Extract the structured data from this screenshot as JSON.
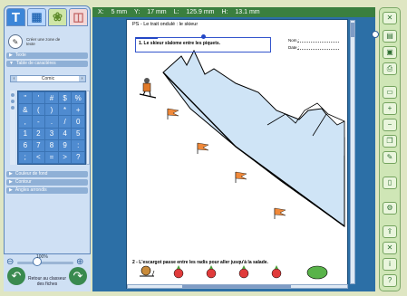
{
  "left_panel": {
    "tabs": [
      {
        "label": "T",
        "icon": "text-icon"
      },
      {
        "label": "",
        "icon": "grid-icon"
      },
      {
        "label": "",
        "icon": "image-icon"
      },
      {
        "label": "",
        "icon": "shapes-icon"
      }
    ],
    "text_box_tool": {
      "label": "Créer une zone de texte"
    },
    "sections": {
      "text": "Texte",
      "char_table": "Table de caractères",
      "bg_color": "Couleur de fond",
      "border": "Contour",
      "rounded_corners": "Angles arrondis"
    },
    "font_select": "Comic",
    "characters": [
      "\"",
      "'",
      "#",
      "$",
      "%",
      "&",
      "(",
      ")",
      "*",
      "+",
      ",",
      "-",
      ".",
      "/",
      "0",
      "1",
      "2",
      "3",
      "4",
      "5",
      "6",
      "7",
      "8",
      "9",
      ":",
      ";",
      "<",
      "=",
      ">",
      "?"
    ],
    "zoom": {
      "value": "100%"
    },
    "back_button": "Retour au classeur des fiches"
  },
  "coords": {
    "x_label": "X:",
    "x_value": "5 mm",
    "y_label": "Y:",
    "y_value": "17 mm",
    "l_label": "L:",
    "l_value": "125.9 mm",
    "h_label": "H:",
    "h_value": "13.1 mm"
  },
  "document": {
    "title": "PS - Le trait ondulé : le skieur",
    "instruction_1": "1. Le skieur slalome entre les piquets.",
    "name_label": "Nom :",
    "date_label": "Date :",
    "instruction_2": "2 - L'escargot passe entre les radis pour aller jusqu'à la salade."
  },
  "colors": {
    "mountain_fill": "#cfe4f6",
    "flag": "#f0893a",
    "toolbar_green": "#3a7f3f",
    "panel_blue": "#cfe0f4"
  },
  "right_toolbar": {
    "buttons": [
      "close-icon",
      "open-icon",
      "save-icon",
      "print-icon",
      "page-icon",
      "add-page-icon",
      "delete-page-icon",
      "copy-icon",
      "edit-icon",
      "new-icon",
      "settings-icon",
      "export-icon",
      "delete-icon",
      "info-icon",
      "help-icon"
    ]
  }
}
